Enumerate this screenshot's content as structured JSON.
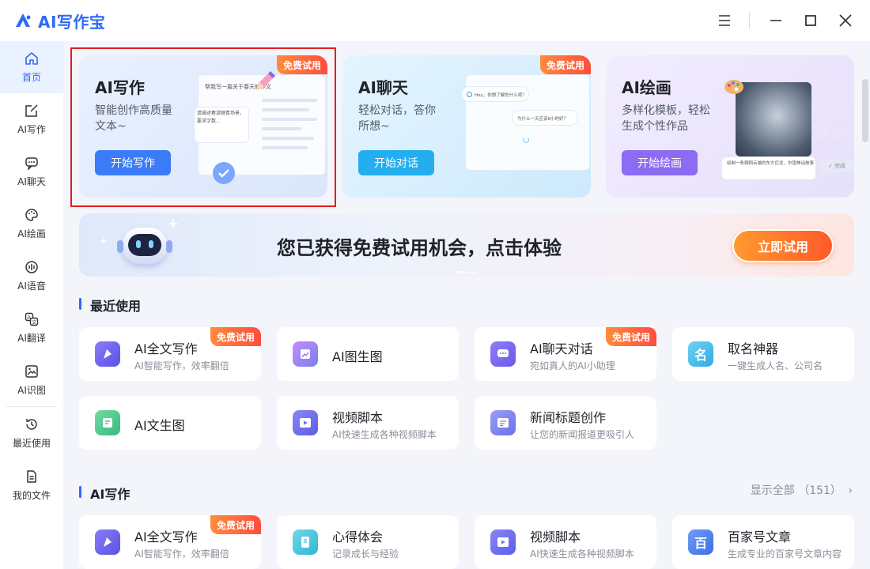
{
  "app": {
    "title": "AI写作宝"
  },
  "sidebar": {
    "items": [
      {
        "label": "首页",
        "icon": "home-icon"
      },
      {
        "label": "AI写作",
        "icon": "edit-icon"
      },
      {
        "label": "AI聊天",
        "icon": "chat-icon"
      },
      {
        "label": "AI绘画",
        "icon": "palette-icon"
      },
      {
        "label": "AI语音",
        "icon": "voice-icon"
      },
      {
        "label": "AI翻译",
        "icon": "translate-icon"
      },
      {
        "label": "AI识图",
        "icon": "image-recognition-icon"
      },
      {
        "label": "最近使用",
        "icon": "history-icon"
      },
      {
        "label": "我的文件",
        "icon": "file-icon"
      }
    ]
  },
  "features": [
    {
      "title": "AI写作",
      "desc": "智能创作高质量文本~",
      "button": "开始写作",
      "tag": "免费试用",
      "mock_prompt": "帮我写一篇关于春天的作文",
      "mock_reply": "请描述春游踏青场景，要求字数..."
    },
    {
      "title": "AI聊天",
      "desc": "轻松对话，答你所想~",
      "button": "开始对话",
      "tag": "免费试用",
      "mock_q": "Hey，你想了解些什么呢？",
      "mock_a": "为什么一天应该8小时好？"
    },
    {
      "title": "AI绘画",
      "desc": "多样化模板，轻松生成个性作品",
      "button": "开始绘画",
      "mock_prompt": "绘制一条翱翔云端的东方巨龙，中国神话故事",
      "mock_done": "完成"
    }
  ],
  "banner": {
    "text": "您已获得免费试用机会，点击体验",
    "button": "立即试用"
  },
  "recent": {
    "title": "最近使用",
    "cards": [
      {
        "name": "AI全文写作",
        "sub": "AI智能写作，效率翻倍",
        "tag": "免费试用",
        "icon": "fulltext-write-icon",
        "color": "#6b5cf0"
      },
      {
        "name": "AI图生图",
        "sub": "",
        "tag": "",
        "icon": "image-to-image-icon",
        "color": "#a66cf0"
      },
      {
        "name": "AI聊天对话",
        "sub": "宛如真人的AI小助理",
        "tag": "免费试用",
        "icon": "ai-chat-icon",
        "color": "#7a6cf2"
      },
      {
        "name": "取名神器",
        "sub": "一键生成人名、公司名",
        "tag": "",
        "icon": "naming-icon",
        "color": "#3fb8e8"
      },
      {
        "name": "AI文生图",
        "sub": "",
        "tag": "",
        "icon": "text-to-image-icon",
        "color": "#46c98a"
      },
      {
        "name": "视频脚本",
        "sub": "AI快速生成各种视频脚本",
        "tag": "",
        "icon": "video-script-icon",
        "color": "#6a6cf0"
      },
      {
        "name": "新闻标题创作",
        "sub": "让您的新闻报道更吸引人",
        "tag": "",
        "icon": "news-title-icon",
        "color": "#7b7ff0"
      }
    ]
  },
  "ai_writing": {
    "title": "AI写作",
    "show_all": "显示全部 （151）",
    "cards": [
      {
        "name": "AI全文写作",
        "sub": "AI智能写作，效率翻倍",
        "tag": "免费试用",
        "icon": "fulltext-write-icon",
        "color": "#6b5cf0"
      },
      {
        "name": "心得体会",
        "sub": "记录成长与经验",
        "tag": "",
        "icon": "experience-icon",
        "color": "#3ec3e0"
      },
      {
        "name": "视频脚本",
        "sub": "AI快速生成各种视频脚本",
        "tag": "",
        "icon": "video-script-icon",
        "color": "#6a6cf0"
      },
      {
        "name": "百家号文章",
        "sub": "生成专业的百家号文章内容",
        "tag": "",
        "icon": "baijiahao-icon",
        "color": "#4a7cf0",
        "glyph": "百"
      }
    ]
  },
  "colors": {
    "accent": "#2d6af6",
    "tag": "#ff5a3d",
    "highlight": "#e11d1d"
  }
}
